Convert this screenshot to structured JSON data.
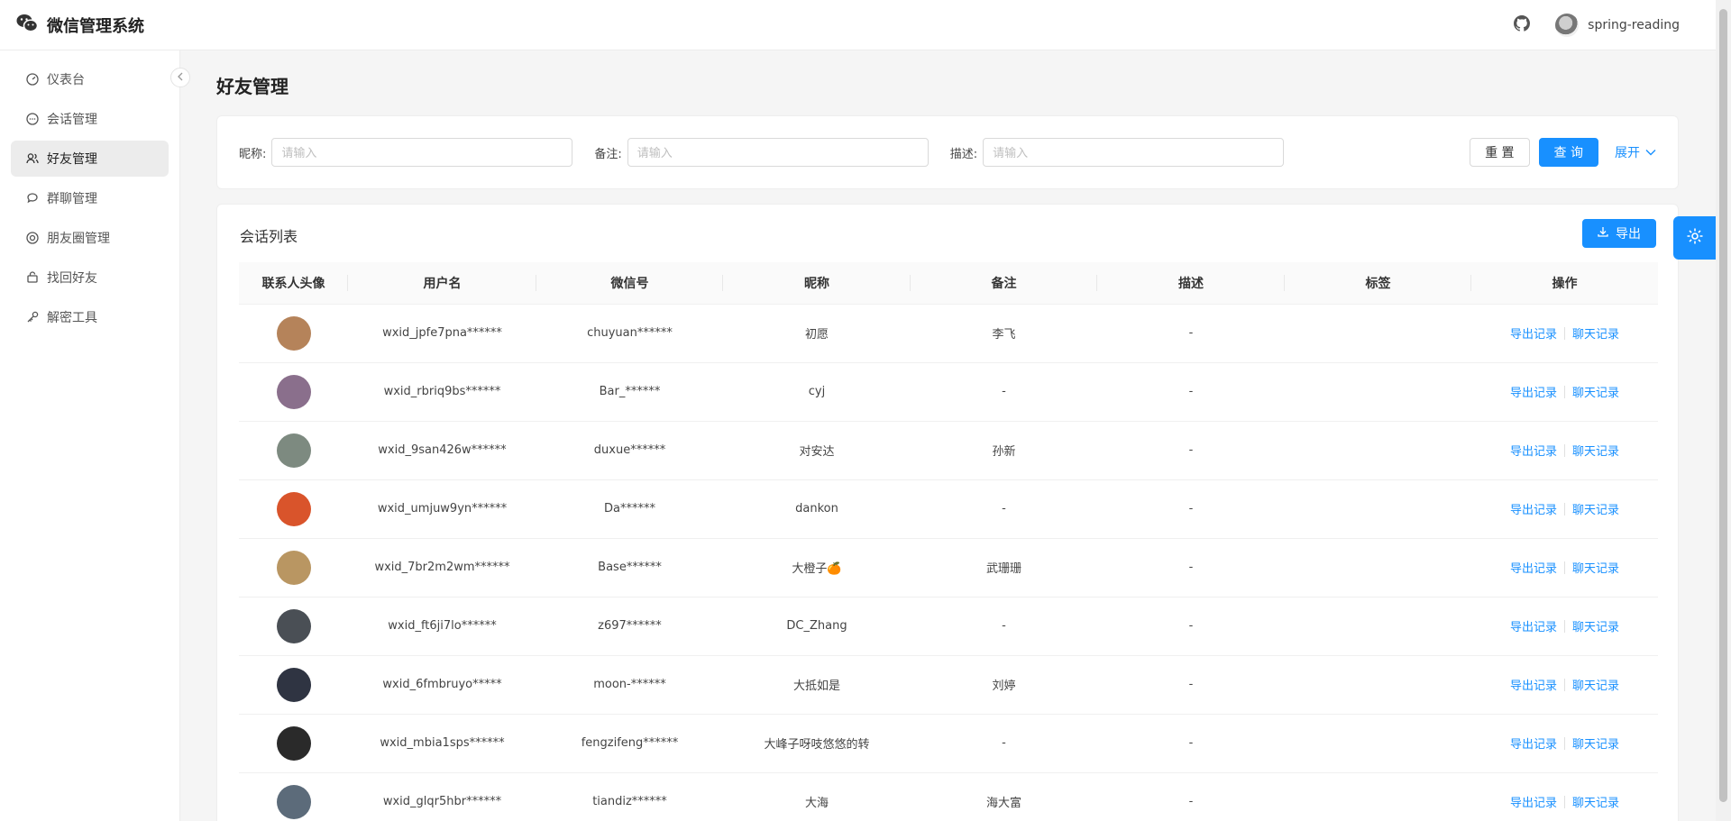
{
  "app": {
    "title": "微信管理系统"
  },
  "header": {
    "username": "spring-reading"
  },
  "sidebar": {
    "items": [
      {
        "label": "仪表台",
        "icon": "dashboard-icon",
        "active": false
      },
      {
        "label": "会话管理",
        "icon": "chat-icon",
        "active": false
      },
      {
        "label": "好友管理",
        "icon": "friends-icon",
        "active": true
      },
      {
        "label": "群聊管理",
        "icon": "group-chat-icon",
        "active": false
      },
      {
        "label": "朋友圈管理",
        "icon": "moments-icon",
        "active": false
      },
      {
        "label": "找回好友",
        "icon": "recover-friend-icon",
        "active": false
      },
      {
        "label": "解密工具",
        "icon": "key-icon",
        "active": false
      }
    ]
  },
  "page": {
    "title": "好友管理"
  },
  "filters": {
    "nickname_label": "昵称:",
    "remark_label": "备注:",
    "description_label": "描述:",
    "nickname_placeholder": "请输入",
    "remark_placeholder": "请输入",
    "description_placeholder": "请输入",
    "reset_label": "重 置",
    "query_label": "查 询",
    "expand_label": "展开"
  },
  "table": {
    "title": "会话列表",
    "export_label": "导出",
    "columns": [
      "联系人头像",
      "用户名",
      "微信号",
      "昵称",
      "备注",
      "描述",
      "标签",
      "操作"
    ],
    "action_export": "导出记录",
    "action_chat": "聊天记录",
    "rows": [
      {
        "username": "wxid_jpfe7pna******",
        "wechat_id": "chuyuan******",
        "nickname": "初愿",
        "remark": "李飞",
        "description": "-",
        "tags": "",
        "avatar_color": "#b5835a"
      },
      {
        "username": "wxid_rbriq9bs******",
        "wechat_id": "Bar_******",
        "nickname": "cyj",
        "remark": "-",
        "description": "-",
        "tags": "",
        "avatar_color": "#8a6f8c"
      },
      {
        "username": "wxid_9san426w******",
        "wechat_id": "duxue******",
        "nickname": "对安达",
        "remark": "孙新",
        "description": "-",
        "tags": "",
        "avatar_color": "#7d8a80"
      },
      {
        "username": "wxid_umjuw9yn******",
        "wechat_id": "Da******",
        "nickname": "dankon",
        "remark": "-",
        "description": "-",
        "tags": "",
        "avatar_color": "#d9542b"
      },
      {
        "username": "wxid_7br2m2wm******",
        "wechat_id": "Base******",
        "nickname": "大橙子🍊",
        "remark": "武珊珊",
        "description": "-",
        "tags": "",
        "avatar_color": "#b99662"
      },
      {
        "username": "wxid_ft6ji7lo******",
        "wechat_id": "z697******",
        "nickname": "DC_Zhang",
        "remark": "-",
        "description": "-",
        "tags": "",
        "avatar_color": "#4a4f55"
      },
      {
        "username": "wxid_6fmbruyo*****",
        "wechat_id": "moon-******",
        "nickname": "大抵如是",
        "remark": "刘婷",
        "description": "-",
        "tags": "",
        "avatar_color": "#2f3442"
      },
      {
        "username": "wxid_mbia1sps******",
        "wechat_id": "fengzifeng******",
        "nickname": "大峰子呀吱悠悠的转",
        "remark": "-",
        "description": "-",
        "tags": "",
        "avatar_color": "#2a2a2a"
      },
      {
        "username": "wxid_glqr5hbr******",
        "wechat_id": "tiandiz******",
        "nickname": "大海",
        "remark": "海大富",
        "description": "-",
        "tags": "",
        "avatar_color": "#5c6b7a"
      }
    ]
  },
  "colors": {
    "primary": "#1890ff",
    "background": "#f5f5f5"
  }
}
